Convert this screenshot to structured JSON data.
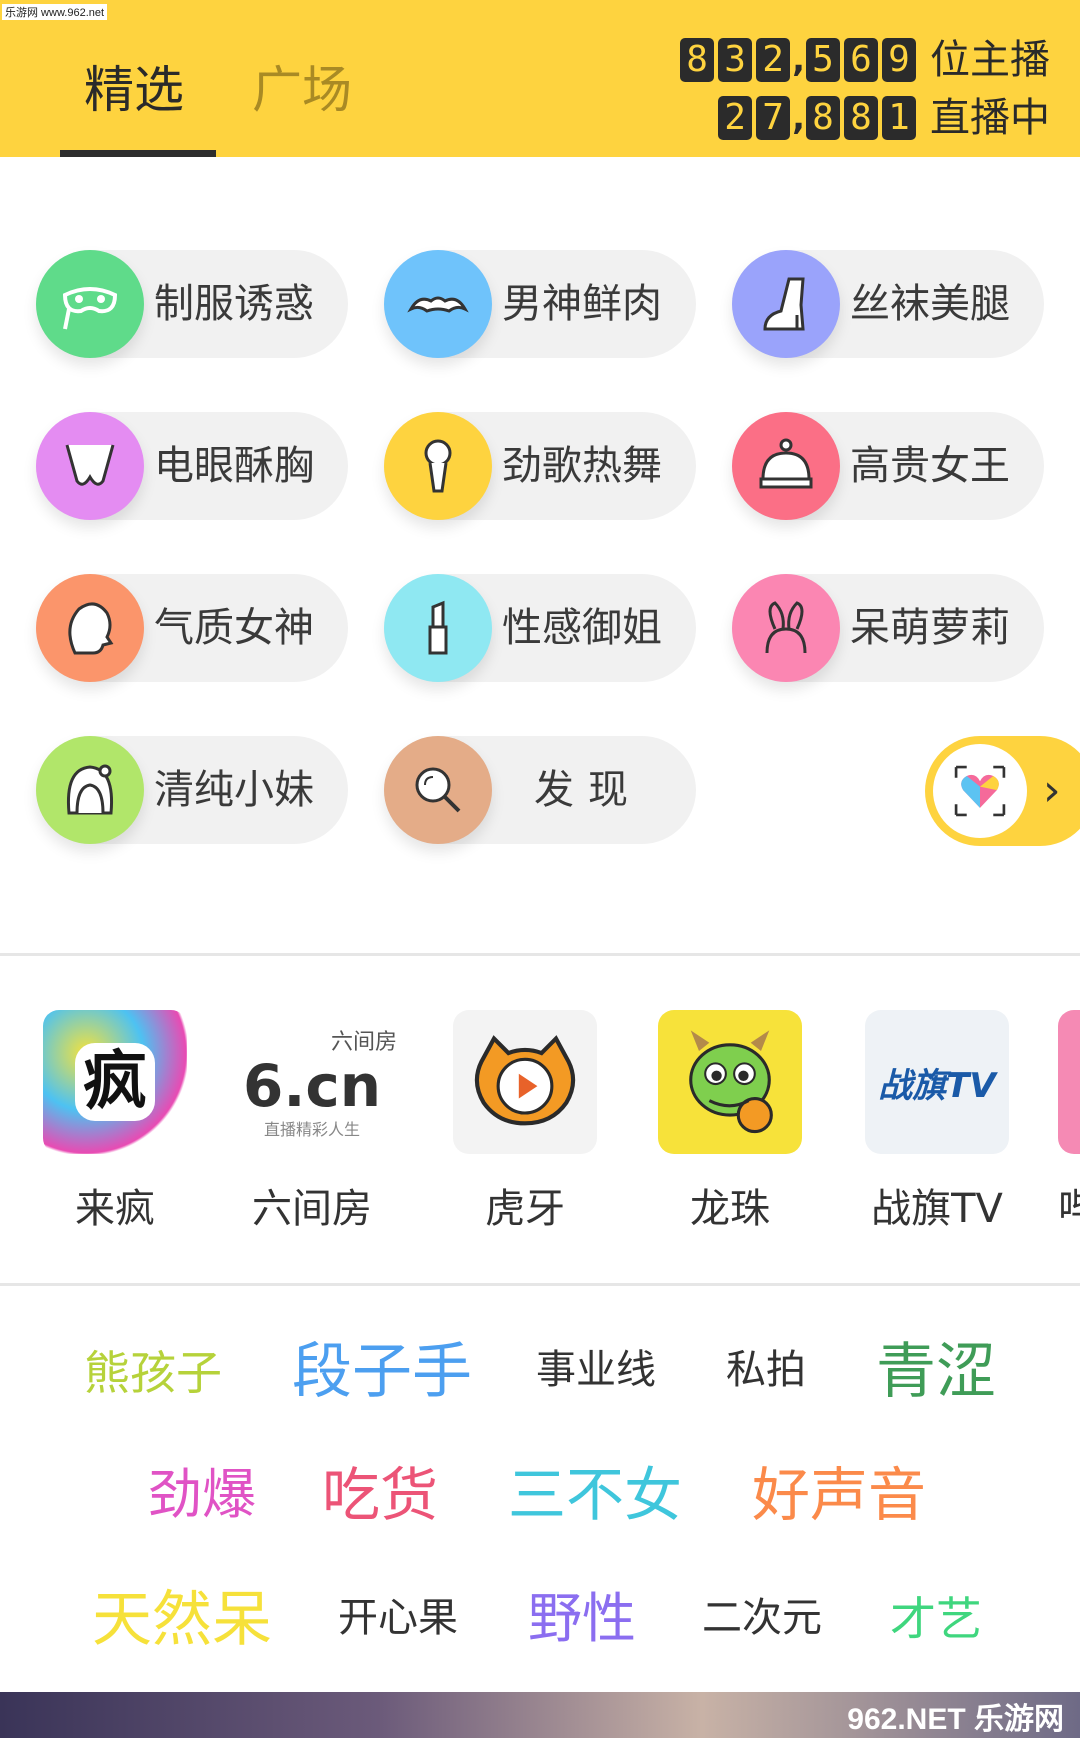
{
  "watermark_top": "乐游网 www.962.net",
  "header": {
    "tabs": [
      {
        "label": "精选",
        "active": true
      },
      {
        "label": "广场",
        "active": false
      }
    ],
    "anchors_digits": [
      "8",
      "3",
      "2",
      ",",
      "5",
      "6",
      "9"
    ],
    "anchors_label": "位主播",
    "live_digits": [
      "2",
      "7",
      ",",
      "8",
      "8",
      "1"
    ],
    "live_label": "直播中"
  },
  "categories": [
    {
      "label": "制服诱惑",
      "icon": "mask-icon",
      "color": "#5fdb8a"
    },
    {
      "label": "男神鲜肉",
      "icon": "mustache-icon",
      "color": "#6fc3fb"
    },
    {
      "label": "丝袜美腿",
      "icon": "high-heel-icon",
      "color": "#9aa3fb"
    },
    {
      "label": "电眼酥胸",
      "icon": "bra-icon",
      "color": "#e48cf2"
    },
    {
      "label": "劲歌热舞",
      "icon": "microphone-icon",
      "color": "#fed33f"
    },
    {
      "label": "高贵女王",
      "icon": "crown-icon",
      "color": "#fb6f86"
    },
    {
      "label": "气质女神",
      "icon": "woman-profile-icon",
      "color": "#fb956b"
    },
    {
      "label": "性感御姐",
      "icon": "lipstick-icon",
      "color": "#8fe8f2"
    },
    {
      "label": "呆萌萝莉",
      "icon": "bunny-ears-icon",
      "color": "#fb86b2"
    },
    {
      "label": "清纯小妹",
      "icon": "girl-hair-icon",
      "color": "#b1e66a"
    },
    {
      "label": "发现",
      "icon": "search-icon",
      "color": "#e4ac88"
    }
  ],
  "discover_badge": {
    "arrow": "›",
    "icon": "heart-scan-icon"
  },
  "platforms": [
    {
      "name": "来疯",
      "logo_text": "疯"
    },
    {
      "name": "六间房",
      "logo_text": "6.cn",
      "logo_sub": "六间房",
      "logo_slogan": "直播精彩人生"
    },
    {
      "name": "虎牙",
      "logo_text": ""
    },
    {
      "name": "龙珠",
      "logo_text": ""
    },
    {
      "name": "战旗TV",
      "logo_text": "战旗TV"
    },
    {
      "name": "哔"
    }
  ],
  "tags": [
    {
      "text": "熊孩子",
      "color": "#b6d23a",
      "size": 46
    },
    {
      "text": "段子手",
      "color": "#4c9ff0",
      "size": 60
    },
    {
      "text": "事业线",
      "color": "#333333",
      "size": 40
    },
    {
      "text": "私拍",
      "color": "#333333",
      "size": 40
    },
    {
      "text": "青涩",
      "color": "#3f9c57",
      "size": 60
    },
    {
      "text": "劲爆",
      "color": "#e053c5",
      "size": 54
    },
    {
      "text": "吃货",
      "color": "#ec5477",
      "size": 58
    },
    {
      "text": "三不女",
      "color": "#3fc6dc",
      "size": 58
    },
    {
      "text": "好声音",
      "color": "#fb8a4a",
      "size": 58
    },
    {
      "text": "天然呆",
      "color": "#f6e13a",
      "size": 60
    },
    {
      "text": "开心果",
      "color": "#333333",
      "size": 40
    },
    {
      "text": "野性",
      "color": "#8b6ef0",
      "size": 54
    },
    {
      "text": "二次元",
      "color": "#333333",
      "size": 40
    },
    {
      "text": "才艺",
      "color": "#3fd67e",
      "size": 46
    }
  ],
  "bottom_watermark": "962.NET 乐游网"
}
